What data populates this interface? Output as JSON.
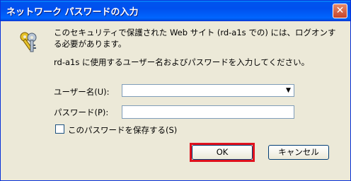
{
  "window": {
    "title": "ネットワーク パスワードの入力",
    "close_glyph": "✕"
  },
  "message": {
    "line1": "このセキュリティで保護された Web サイト (rd-a1s での) には、ログオンする必要があります。",
    "line2": "rd-a1s に使用するユーザー名およびパスワードを入力してください。"
  },
  "form": {
    "username_label": "ユーザー名(U):",
    "password_label": "パスワード(P):",
    "save_password_label": "このパスワードを保存する(S)",
    "username_value": "",
    "password_value": ""
  },
  "buttons": {
    "ok": "OK",
    "cancel": "キャンセル"
  },
  "icons": {
    "dialog_icon": "keys-icon",
    "dropdown": "chevron-down-icon"
  }
}
